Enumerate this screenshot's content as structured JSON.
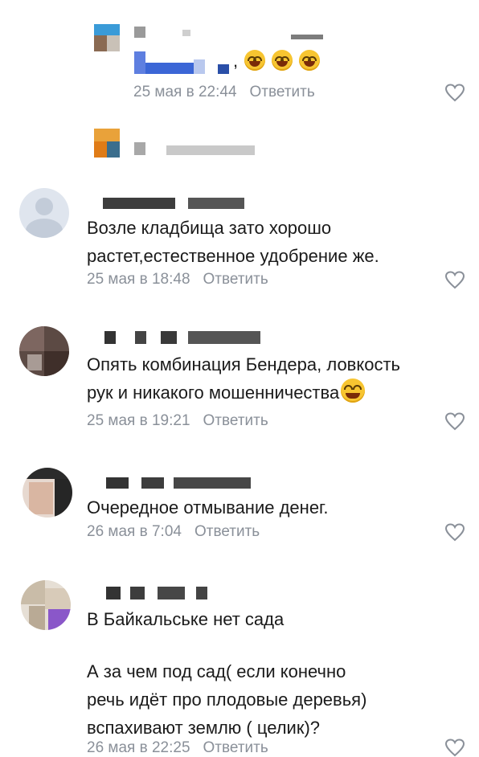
{
  "reply_label": "Ответить",
  "colors": {
    "meta": "#8a9099",
    "text": "#1a1a1a",
    "emoji": "#f7c531"
  },
  "comments": [
    {
      "text_lines": [],
      "emoji_line": ", 🤣🤣🤣",
      "date": "25 мая в 22:44"
    },
    {
      "text_lines": [],
      "date": ""
    },
    {
      "text_lines": [
        "Возле кладбища зато хорошо",
        "растет,естественное удобрение же."
      ],
      "date": "25 мая в 18:48"
    },
    {
      "text_lines": [
        "Опять комбинация Бендера,  ловкость",
        "рук и никакого мошенничества"
      ],
      "date": "25 мая в 19:21"
    },
    {
      "text_lines": [
        "Очередное отмывание денег."
      ],
      "date": "26 мая в 7:04"
    },
    {
      "text_lines": [
        "В Байкальське нет сада",
        "",
        "А за чем под сад( если конечно",
        "речь идёт про плодовые деревья)",
        "вспахивают землю ( целик)?"
      ],
      "date": "26 мая в 22:25"
    }
  ]
}
